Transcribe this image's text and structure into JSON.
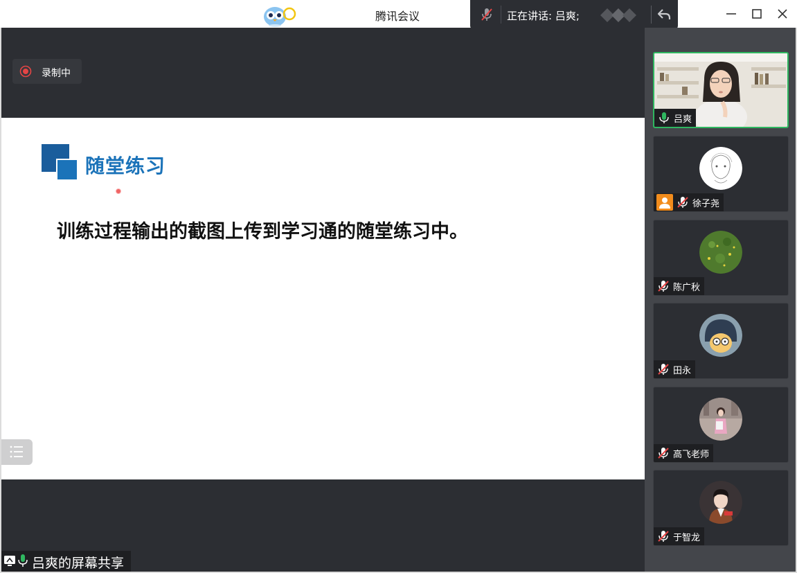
{
  "window": {
    "title": "腾讯会议",
    "speaking_label": "正在讲话: 吕爽;"
  },
  "recording": {
    "label": "录制中"
  },
  "slide": {
    "heading": "随堂练习",
    "body": "训练过程输出的截图上传到学习通的随堂练习中。"
  },
  "share_footer": {
    "label": "吕爽的屏幕共享"
  },
  "participants": [
    {
      "name": "吕爽",
      "mic": "on",
      "video": true
    },
    {
      "name": "徐子尧",
      "mic": "muted",
      "host": true
    },
    {
      "name": "陈广秋",
      "mic": "muted"
    },
    {
      "name": "田永",
      "mic": "muted"
    },
    {
      "name": "高飞老师",
      "mic": "muted"
    },
    {
      "name": "于智龙",
      "mic": "muted"
    }
  ],
  "colors": {
    "accent_green": "#2fb760",
    "slide_blue": "#1b73b9",
    "record_red": "#e54545",
    "host_orange": "#f28c1c"
  },
  "icons": [
    "app-logo-icon",
    "mic-muted-icon",
    "back-icon",
    "minimize-icon",
    "maximize-icon",
    "close-icon",
    "record-icon",
    "list-icon",
    "screen-share-icon",
    "mic-on-icon"
  ]
}
